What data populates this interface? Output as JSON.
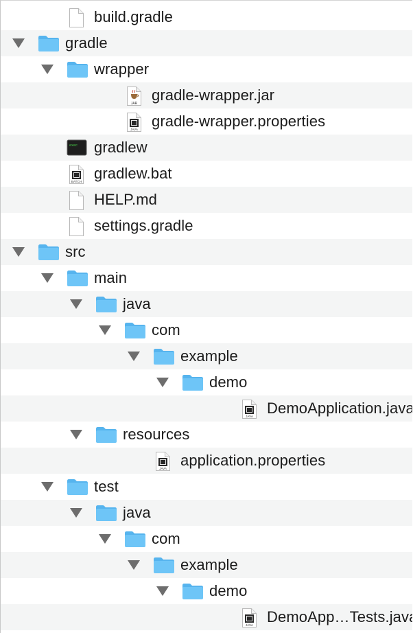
{
  "tree": {
    "rows": [
      {
        "label": "build.gradle",
        "depth": 1,
        "kind": "file-gradle",
        "icon_name": "document-icon",
        "expanded": null
      },
      {
        "label": "gradle",
        "depth": 0,
        "kind": "folder",
        "icon_name": "folder-icon",
        "expanded": true
      },
      {
        "label": "wrapper",
        "depth": 1,
        "kind": "folder",
        "icon_name": "folder-icon",
        "expanded": true
      },
      {
        "label": "gradle-wrapper.jar",
        "depth": 3,
        "kind": "file-jar",
        "icon_name": "jar-file-icon",
        "badge": "JAR",
        "expanded": null
      },
      {
        "label": "gradle-wrapper.properties",
        "depth": 3,
        "kind": "file-java",
        "icon_name": "java-file-icon",
        "badge": "JAVA",
        "expanded": null
      },
      {
        "label": "gradlew",
        "depth": 1,
        "kind": "terminal",
        "icon_name": "terminal-executable-icon",
        "badge": "exec",
        "expanded": null
      },
      {
        "label": "gradlew.bat",
        "depth": 1,
        "kind": "file-batch",
        "icon_name": "batch-file-icon",
        "badge": "BATCH",
        "expanded": null
      },
      {
        "label": "HELP.md",
        "depth": 1,
        "kind": "file-plain",
        "icon_name": "document-icon",
        "expanded": null
      },
      {
        "label": "settings.gradle",
        "depth": 1,
        "kind": "file-plain",
        "icon_name": "document-icon",
        "expanded": null
      },
      {
        "label": "src",
        "depth": 0,
        "kind": "folder",
        "icon_name": "folder-icon",
        "expanded": true
      },
      {
        "label": "main",
        "depth": 1,
        "kind": "folder",
        "icon_name": "folder-icon",
        "expanded": true
      },
      {
        "label": "java",
        "depth": 2,
        "kind": "folder",
        "icon_name": "folder-icon",
        "expanded": true
      },
      {
        "label": "com",
        "depth": 3,
        "kind": "folder",
        "icon_name": "folder-icon",
        "expanded": true
      },
      {
        "label": "example",
        "depth": 4,
        "kind": "folder",
        "icon_name": "folder-icon",
        "expanded": true
      },
      {
        "label": "demo",
        "depth": 5,
        "kind": "folder",
        "icon_name": "folder-icon",
        "expanded": true
      },
      {
        "label": "DemoApplication.java",
        "depth": 7,
        "kind": "file-java",
        "icon_name": "java-file-icon",
        "badge": "JAVA",
        "expanded": null
      },
      {
        "label": "resources",
        "depth": 2,
        "kind": "folder",
        "icon_name": "folder-icon",
        "expanded": true
      },
      {
        "label": "application.properties",
        "depth": 4,
        "kind": "file-java",
        "icon_name": "java-file-icon",
        "badge": "JAVA",
        "expanded": null
      },
      {
        "label": "test",
        "depth": 1,
        "kind": "folder",
        "icon_name": "folder-icon",
        "expanded": true
      },
      {
        "label": "java",
        "depth": 2,
        "kind": "folder",
        "icon_name": "folder-icon",
        "expanded": true
      },
      {
        "label": "com",
        "depth": 3,
        "kind": "folder",
        "icon_name": "folder-icon",
        "expanded": true
      },
      {
        "label": "example",
        "depth": 4,
        "kind": "folder",
        "icon_name": "folder-icon",
        "expanded": true
      },
      {
        "label": "demo",
        "depth": 5,
        "kind": "folder",
        "icon_name": "folder-icon",
        "expanded": true
      },
      {
        "label": "DemoApp…Tests.java",
        "depth": 7,
        "kind": "file-java",
        "icon_name": "java-file-icon",
        "badge": "JAVA",
        "expanded": null
      }
    ]
  },
  "colors": {
    "folder": "#6ec5f7",
    "folder_tab": "#56b4ee",
    "stripe": "#f4f5f5",
    "text": "#1c1c1c",
    "disclosure": "#6d6d6d"
  }
}
